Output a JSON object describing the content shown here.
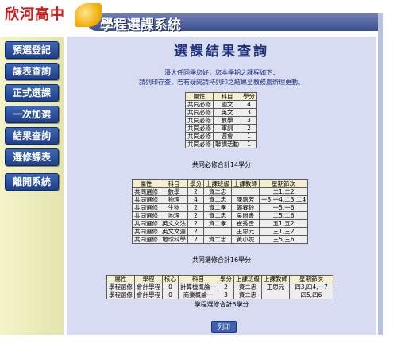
{
  "header": {
    "school": "欣河高中",
    "title": "學程選課系統"
  },
  "sidebar": {
    "items": [
      {
        "label": "預選登記"
      },
      {
        "label": "課表查詢"
      },
      {
        "label": "正式選課"
      },
      {
        "label": "一次加選"
      },
      {
        "label": "結果查詢"
      },
      {
        "label": "選修課表"
      },
      {
        "label": "離開系統"
      }
    ]
  },
  "main": {
    "title": "選課結果查詢",
    "intro_line1": "潘大任同學您好，您本學期之課程如下：",
    "intro_line2": "請列印存查，若有疑問請持列印之結果至教務處辦理更動。",
    "required": {
      "headers": [
        "屬性",
        "科目",
        "學分"
      ],
      "rows": [
        [
          "共同必修",
          "國文",
          "4"
        ],
        [
          "共同必修",
          "英文",
          "3"
        ],
        [
          "共同必修",
          "數學",
          "3"
        ],
        [
          "共同必修",
          "軍訓",
          "2"
        ],
        [
          "共同必修",
          "週會",
          "1"
        ],
        [
          "共同必修",
          "聯課活動",
          "1"
        ]
      ],
      "total": "共同必修合計14學分"
    },
    "elective": {
      "headers": [
        "屬性",
        "科目",
        "學分",
        "上課班級",
        "上課教師",
        "星期節次"
      ],
      "rows": [
        [
          "共同選修",
          "數學",
          "2",
          "資二忠",
          "",
          "二1,二2"
        ],
        [
          "共同選修",
          "物理",
          "4",
          "資二忠",
          "陳惠芳",
          "一3,一4,二3,二4"
        ],
        [
          "共同選修",
          "生物",
          "2",
          "資二孝",
          "鄭春鈴",
          "一5,一6"
        ],
        [
          "共同選修",
          "地理",
          "2",
          "資二忠",
          "吳尚書",
          "二5,二6"
        ],
        [
          "共同選修",
          "英文文法",
          "2",
          "資二孝",
          "崔秀雲",
          "五1,五2"
        ],
        [
          "共同選修",
          "英文文選",
          "2",
          "",
          "王思元",
          "三1,三2"
        ],
        [
          "共同選修",
          "地球科學",
          "2",
          "資二忠",
          "黃小妮",
          "三5,三6"
        ]
      ],
      "total": "共同選修合計16學分"
    },
    "program": {
      "headers": [
        "屬性",
        "學程",
        "核心",
        "科目",
        "學分",
        "上課班級",
        "上課教師",
        "星期節次"
      ],
      "rows": [
        [
          "學程選修",
          "會計學程",
          "0",
          "計算機概論一",
          "2",
          "資二忠",
          "王思元",
          "四3,四4,一7"
        ],
        [
          "學程選修",
          "會計學程",
          "0",
          "商業概論一",
          "3",
          "資二忠",
          "",
          "四5,四6"
        ]
      ],
      "total": "學程選修合計5學分"
    },
    "print_label": "列印"
  }
}
